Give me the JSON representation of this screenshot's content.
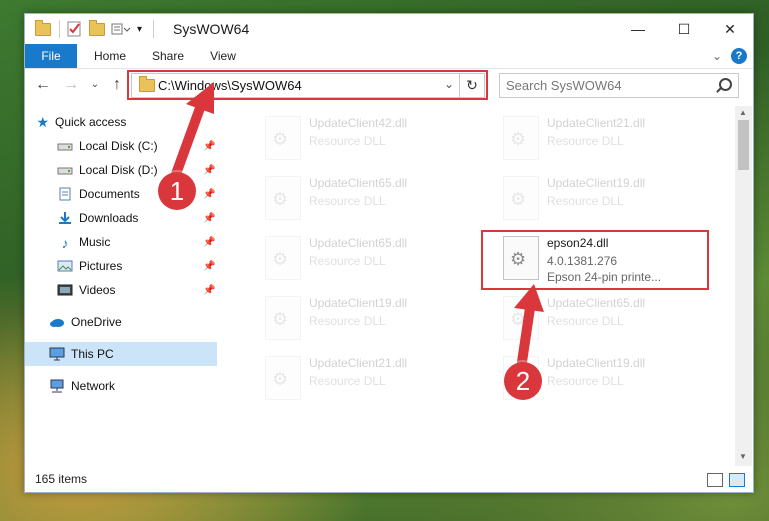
{
  "window": {
    "title": "SysWOW64",
    "minimize": "—",
    "maximize": "☐",
    "close": "✕"
  },
  "ribbon": {
    "tabs": [
      "File",
      "Home",
      "Share",
      "View"
    ],
    "collapse_chevron": "⌄",
    "help": "?"
  },
  "address_bar": {
    "path": "C:\\Windows\\SysWOW64",
    "refresh": "↻",
    "dropdown": "⌄"
  },
  "search": {
    "placeholder": "Search SysWOW64"
  },
  "nav_pane": {
    "quick_access": "Quick access",
    "items": [
      {
        "label": "Local Disk (C:)",
        "icon": "drive-icon",
        "pinned": true
      },
      {
        "label": "Local Disk (D:)",
        "icon": "drive-icon",
        "pinned": true
      },
      {
        "label": "Documents",
        "icon": "documents-icon",
        "pinned": true
      },
      {
        "label": "Downloads",
        "icon": "downloads-icon",
        "pinned": true
      },
      {
        "label": "Music",
        "icon": "music-icon",
        "pinned": true
      },
      {
        "label": "Pictures",
        "icon": "pictures-icon",
        "pinned": true
      },
      {
        "label": "Videos",
        "icon": "videos-icon",
        "pinned": true
      }
    ],
    "onedrive": "OneDrive",
    "this_pc": "This PC",
    "network": "Network"
  },
  "files": [
    {
      "name": "UpdateClient42.dll",
      "type": "Resource DLL",
      "faded": true
    },
    {
      "name": "UpdateClient21.dll",
      "type": "Resource DLL",
      "faded": true
    },
    {
      "name": "UpdateClient65.dll",
      "type": "Resource DLL",
      "faded": true
    },
    {
      "name": "UpdateClient19.dll",
      "type": "Resource DLL",
      "faded": true
    },
    {
      "name": "UpdateClient65.dll",
      "type": "Resource DLL",
      "faded": true
    },
    {
      "name": "epson24.dll",
      "version": "4.0.1381.276",
      "description": "Epson 24-pin printe...",
      "faded": false
    },
    {
      "name": "UpdateClient19.dll",
      "type": "Resource DLL",
      "faded": true
    },
    {
      "name": "UpdateClient65.dll",
      "type": "Resource DLL",
      "faded": true
    },
    {
      "name": "UpdateClient21.dll",
      "type": "Resource DLL",
      "faded": true
    },
    {
      "name": "UpdateClient19.dll",
      "type": "Resource DLL",
      "faded": true
    }
  ],
  "status_bar": {
    "item_count": "165 items"
  },
  "callouts": {
    "one": "1",
    "two": "2"
  },
  "colors": {
    "accent": "#1979ca",
    "callout_red": "#d9373b",
    "selection": "#cce4f7"
  }
}
